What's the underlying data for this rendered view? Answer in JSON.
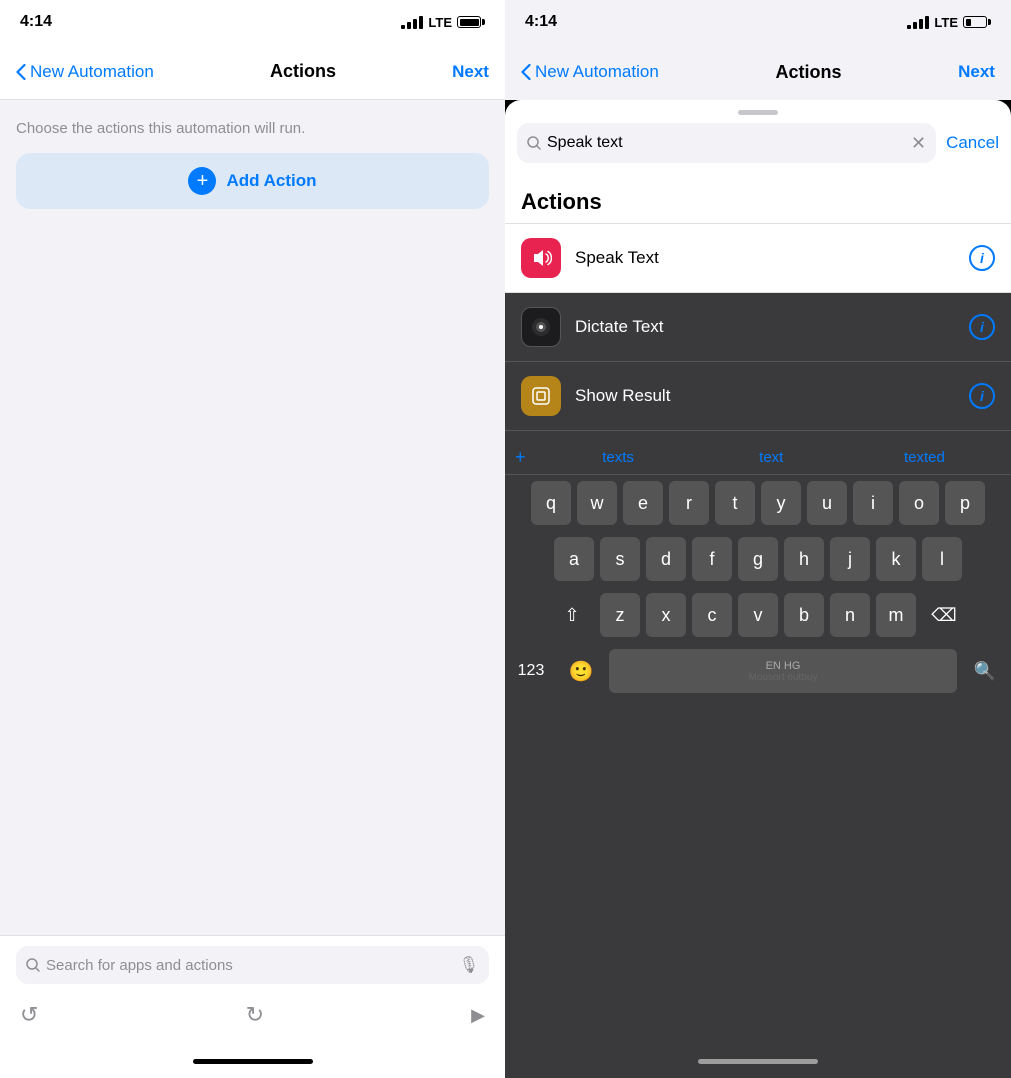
{
  "leftPhone": {
    "statusBar": {
      "time": "4:14",
      "signal": "signal",
      "carrier": "LTE",
      "battery": "full"
    },
    "navBar": {
      "backLabel": "New Automation",
      "title": "Actions",
      "nextLabel": "Next"
    },
    "content": {
      "subtitle": "Choose the actions this automation will run.",
      "addActionLabel": "Add Action"
    },
    "bottomBar": {
      "searchPlaceholder": "Search for apps and actions"
    },
    "navArrows": {
      "undoLabel": "undo",
      "redoLabel": "redo",
      "playLabel": "play"
    }
  },
  "rightPhone": {
    "statusBar": {
      "time": "4:14",
      "signal": "signal",
      "carrier": "LTE",
      "battery": "low"
    },
    "navBar": {
      "backLabel": "New Automation",
      "title": "Actions",
      "nextLabel": "Next"
    },
    "sheet": {
      "searchValue": "Speak text",
      "cancelLabel": "Cancel",
      "sectionTitle": "Actions",
      "actions": [
        {
          "name": "Speak Text",
          "iconBg": "#e8234f",
          "iconColor": "#fff",
          "iconSymbol": "🔊",
          "dark": false
        },
        {
          "name": "Dictate Text",
          "iconBg": "#1c1c1e",
          "iconColor": "#fff",
          "iconSymbol": "⏺",
          "dark": true
        },
        {
          "name": "Show Result",
          "iconBg": "#b5851a",
          "iconColor": "#fff",
          "iconSymbol": "⊡",
          "dark": true
        }
      ]
    },
    "keyboard": {
      "suggestions": [
        "texts",
        "text",
        "texted"
      ],
      "rows": [
        [
          "q",
          "w",
          "e",
          "r",
          "t",
          "y",
          "u",
          "i",
          "o",
          "p"
        ],
        [
          "a",
          "s",
          "d",
          "f",
          "g",
          "h",
          "j",
          "k",
          "l"
        ],
        [
          "z",
          "x",
          "c",
          "v",
          "b",
          "n",
          "m"
        ]
      ],
      "spacePlaceholder": "EN HG",
      "spaceSubtext": "Moosort outbuy"
    }
  }
}
